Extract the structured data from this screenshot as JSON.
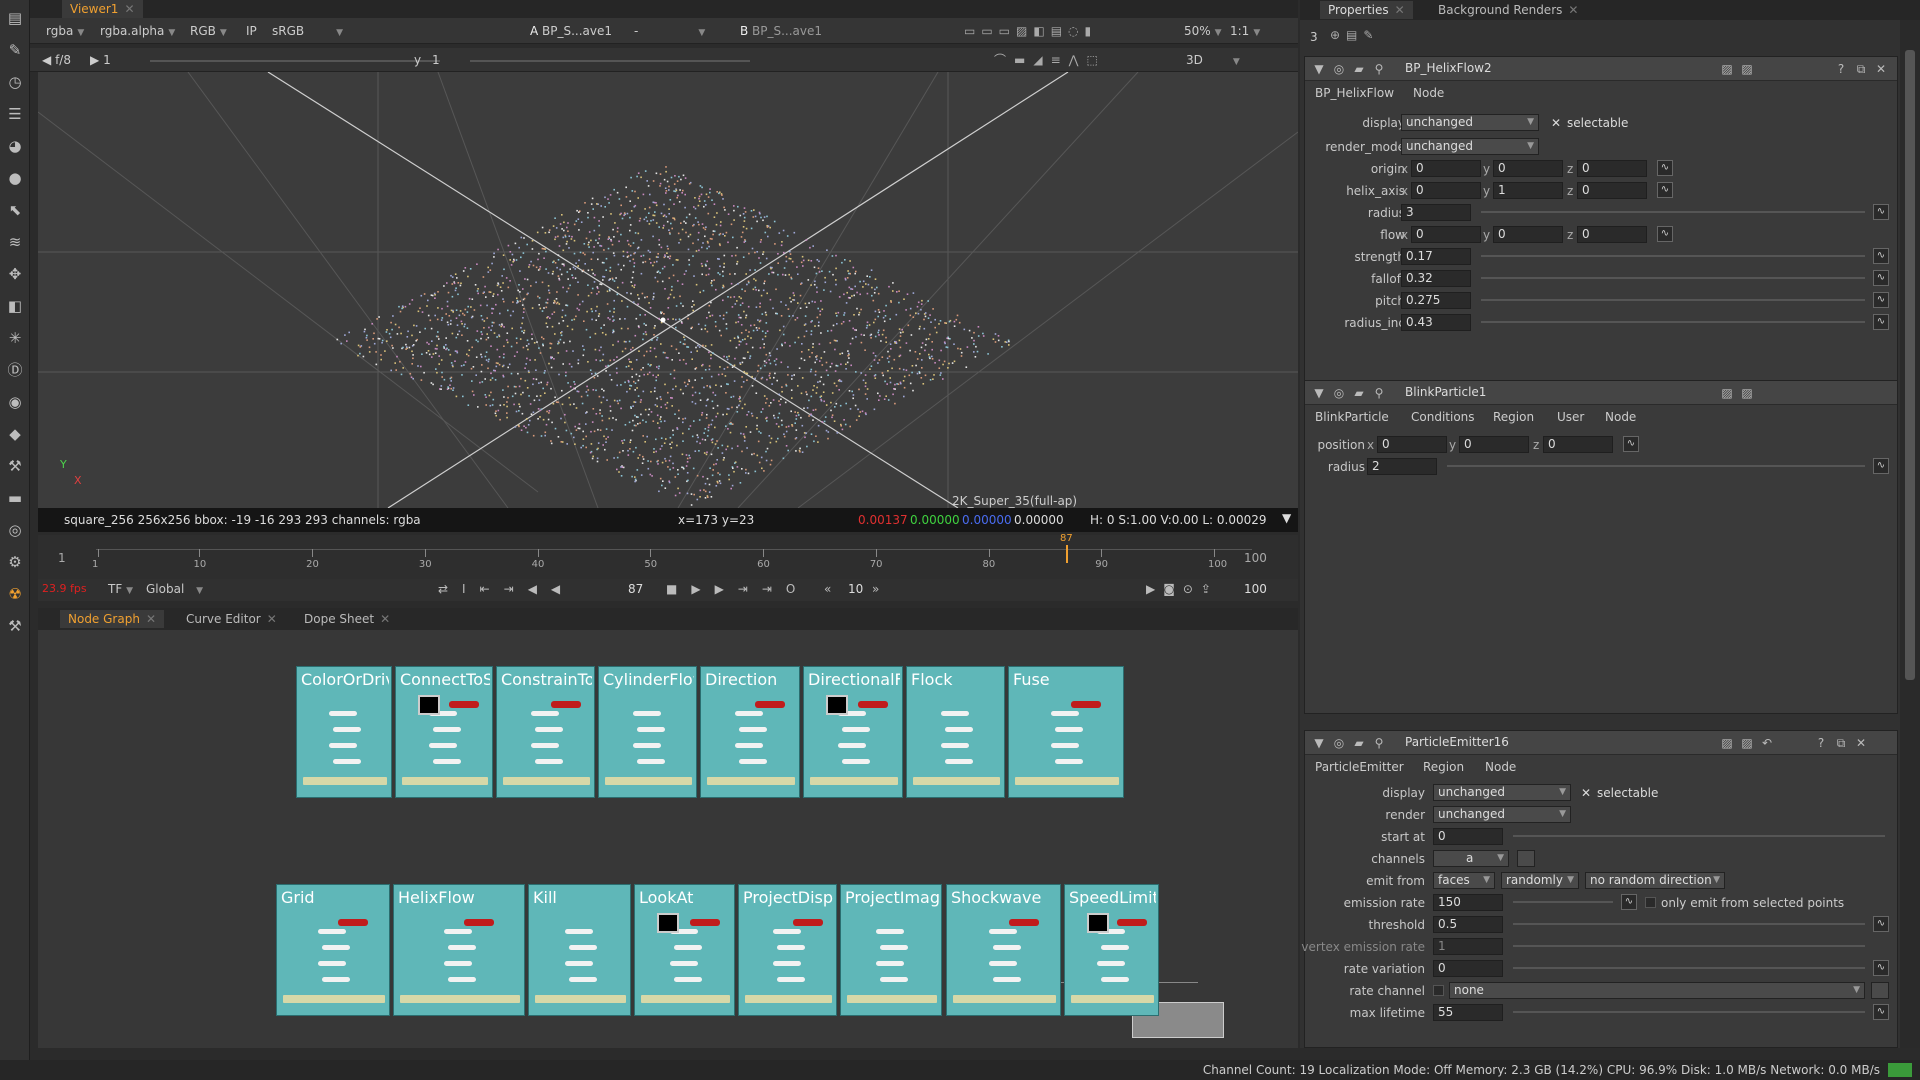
{
  "viewer": {
    "tab": "Viewer1",
    "row1": {
      "channels": "rgba",
      "alpha": "rgba.alpha",
      "display": "RGB",
      "ip": "IP",
      "lut": "sRGB",
      "a_label": "A",
      "a_input": "BP_S...ave1",
      "ab_op": "-",
      "b_label": "B",
      "b_input": "BP_S...ave1",
      "zoom": "50%",
      "ratio": "1:1"
    },
    "row2": {
      "fstop": "f/8",
      "gain": "1",
      "gamma_label": "y",
      "gamma": "1",
      "mode": "3D"
    },
    "format_label": "2K_Super_35(full-ap)",
    "axis_y": "Y",
    "axis_x": "X",
    "info": {
      "left": "square_256 256x256  bbox: -19 -16 293 293 channels: rgba",
      "coords": "x=173 y=23",
      "r": "0.00137",
      "g": "0.00000",
      "b": "0.00000",
      "a": "0.00000",
      "hsvl": "H:  0 S:1.00 V:0.00  L: 0.00029"
    }
  },
  "timeline": {
    "start": "1",
    "end": "100",
    "current": "87",
    "ticks": [
      "1",
      "10",
      "20",
      "30",
      "40",
      "50",
      "60",
      "70",
      "80",
      "90",
      "100"
    ],
    "fps": "23.9 fps",
    "tf": "TF",
    "scope": "Global",
    "frame": "87",
    "step": "10",
    "out": "100"
  },
  "nodegraph": {
    "tabs": [
      "Node Graph",
      "Curve Editor",
      "Dope Sheet"
    ],
    "row1": [
      "ColorOrDrive",
      "ConnectToSphere",
      "ConstrainToSphere",
      "CylinderFlow",
      "Direction",
      "DirectionalForce",
      "Flock",
      "Fuse"
    ],
    "row2": [
      "Grid",
      "HelixFlow",
      "Kill",
      "LookAt",
      "ProjectDisplace",
      "ProjectImage",
      "Shockwave",
      "SpeedLimit"
    ]
  },
  "properties": {
    "tabs": [
      "Properties",
      "Background Renders"
    ],
    "max_panels": "3",
    "helix": {
      "title": "BP_HelixFlow2",
      "tabs": [
        "BP_HelixFlow",
        "Node"
      ],
      "display_label": "display",
      "display": "unchanged",
      "selectable": "selectable",
      "render_mode_label": "render_mode",
      "render_mode": "unchanged",
      "origin_label": "origin",
      "origin": {
        "x": "0",
        "y": "0",
        "z": "0"
      },
      "helix_axis_label": "helix_axis",
      "helix_axis": {
        "x": "0",
        "y": "1",
        "z": "0"
      },
      "radius_label": "radius",
      "radius": "3",
      "flow_label": "flow",
      "flow": {
        "x": "0",
        "y": "0",
        "z": "0"
      },
      "strength_label": "strength",
      "strength": "0.17",
      "falloff_label": "falloff",
      "falloff": "0.32",
      "pitch_label": "pitch",
      "pitch": "0.275",
      "radius_inc_label": "radius_inc",
      "radius_inc": "0.43"
    },
    "blink": {
      "title": "BlinkParticle1",
      "tabs": [
        "BlinkParticle",
        "Conditions",
        "Region",
        "User",
        "Node"
      ],
      "position_label": "position",
      "position": {
        "x": "0",
        "y": "0",
        "z": "0"
      },
      "radius_label": "radius",
      "radius": "2"
    },
    "emitter": {
      "title": "ParticleEmitter16",
      "tabs": [
        "ParticleEmitter",
        "Region",
        "Node"
      ],
      "display_label": "display",
      "display": "unchanged",
      "selectable": "selectable",
      "render_label": "render",
      "render": "unchanged",
      "start_at_label": "start at",
      "start_at": "0",
      "channels_label": "channels",
      "channels": "a",
      "emit_from_label": "emit from",
      "emit_from": "faces",
      "emit_order": "randomly",
      "emit_dir": "no random direction",
      "emission_rate_label": "emission rate",
      "emission_rate": "150",
      "only_selected": "only emit from selected points",
      "threshold_label": "threshold",
      "threshold": "0.5",
      "vertex_rate_label": "vertex emission rate",
      "vertex_rate": "1",
      "rate_variation_label": "rate variation",
      "rate_variation": "0",
      "rate_channel_label": "rate channel",
      "rate_channel": "none",
      "max_lifetime_label": "max lifetime",
      "max_lifetime": "55"
    }
  },
  "status": "Channel Count: 19  Localization Mode: Off  Memory: 2.3 GB (14.2%)  CPU: 96.9%  Disk: 1.0 MB/s  Network: 0.0 MB/s",
  "colors": {
    "node": "#5fb7b8",
    "accent": "#f0a030",
    "background": "#2b2b2b"
  }
}
